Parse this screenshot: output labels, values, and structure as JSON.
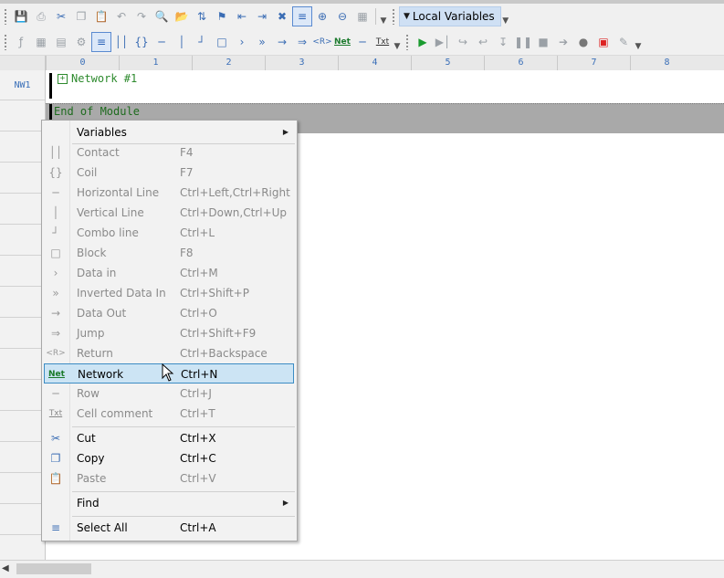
{
  "toolbar1": {
    "icons": [
      "save-icon",
      "print-icon",
      "cut-icon",
      "copy-icon",
      "paste-icon",
      "undo-icon",
      "redo-icon",
      "find-icon",
      "replace-icon",
      "replace-all-icon",
      "bookmark-icon",
      "bookmark-prev-icon",
      "bookmark-next-icon",
      "bookmark-clear-icon",
      "select-all-icon",
      "zoom-in-icon",
      "zoom-out-icon",
      "grid-icon"
    ],
    "local_vars_label": "Local Variables"
  },
  "toolbar2": {
    "net_label": "Net",
    "txt_label": "Txt"
  },
  "ruler": {
    "columns": [
      "0",
      "1",
      "2",
      "3",
      "4",
      "5",
      "6",
      "7",
      "8"
    ]
  },
  "gutter": {
    "nw_label": "NW1"
  },
  "editor": {
    "network_title": "Network #1",
    "end_text": "End of Module"
  },
  "context_menu": {
    "items": [
      {
        "label": "Variables",
        "shortcut": "",
        "enabled": true,
        "submenu": true,
        "icon": ""
      },
      {
        "label": "Contact",
        "shortcut": "F4",
        "enabled": false,
        "icon": "contact-icon"
      },
      {
        "label": "Coil",
        "shortcut": "F7",
        "enabled": false,
        "icon": "coil-icon"
      },
      {
        "label": "Horizontal Line",
        "shortcut": "Ctrl+Left,Ctrl+Right",
        "enabled": false,
        "icon": "hline-icon"
      },
      {
        "label": "Vertical Line",
        "shortcut": "Ctrl+Down,Ctrl+Up",
        "enabled": false,
        "icon": "vline-icon"
      },
      {
        "label": "Combo line",
        "shortcut": "Ctrl+L",
        "enabled": false,
        "icon": "combo-line-icon"
      },
      {
        "label": "Block",
        "shortcut": "F8",
        "enabled": false,
        "icon": "block-icon"
      },
      {
        "label": "Data in",
        "shortcut": "Ctrl+M",
        "enabled": false,
        "icon": "data-in-icon"
      },
      {
        "label": "Inverted Data In",
        "shortcut": "Ctrl+Shift+P",
        "enabled": false,
        "icon": "inverted-data-in-icon"
      },
      {
        "label": "Data Out",
        "shortcut": "Ctrl+O",
        "enabled": false,
        "icon": "data-out-icon"
      },
      {
        "label": "Jump",
        "shortcut": "Ctrl+Shift+F9",
        "enabled": false,
        "icon": "jump-icon"
      },
      {
        "label": "Return",
        "shortcut": "Ctrl+Backspace",
        "enabled": false,
        "icon": "return-icon"
      },
      {
        "label": "Network",
        "shortcut": "Ctrl+N",
        "enabled": true,
        "selected": true,
        "icon": "network-icon"
      },
      {
        "label": "Row",
        "shortcut": "Ctrl+J",
        "enabled": false,
        "icon": "row-icon"
      },
      {
        "label": "Cell comment",
        "shortcut": "Ctrl+T",
        "enabled": false,
        "icon": "cell-comment-icon"
      },
      {
        "label": "Cut",
        "shortcut": "Ctrl+X",
        "enabled": true,
        "icon": "cut-icon"
      },
      {
        "label": "Copy",
        "shortcut": "Ctrl+C",
        "enabled": true,
        "icon": "copy-icon"
      },
      {
        "label": "Paste",
        "shortcut": "Ctrl+V",
        "enabled": false,
        "icon": "paste-icon"
      },
      {
        "label": "Find",
        "shortcut": "",
        "enabled": true,
        "submenu": true,
        "icon": ""
      },
      {
        "label": "Select All",
        "shortcut": "Ctrl+A",
        "enabled": true,
        "icon": "select-all-icon"
      }
    ],
    "ret_glyph": "<R>",
    "net_glyph": "Net",
    "txt_glyph": "Txt"
  }
}
